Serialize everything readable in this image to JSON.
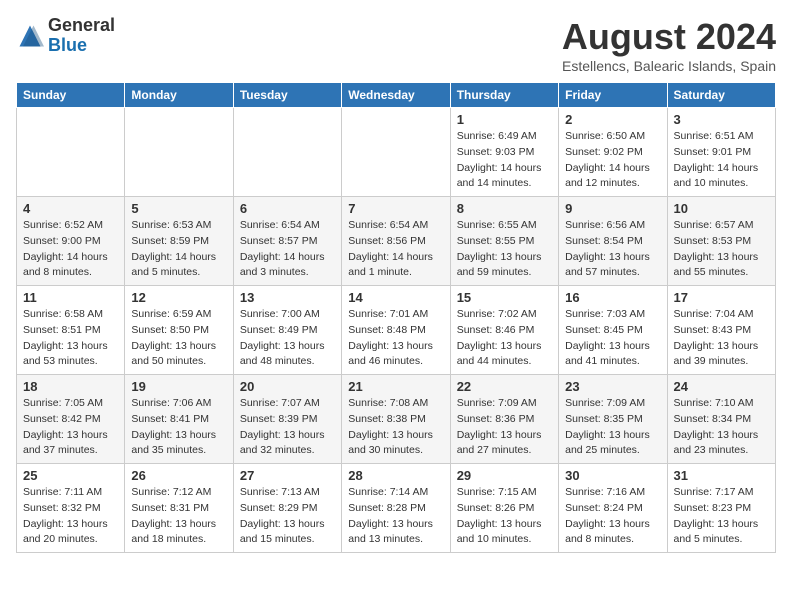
{
  "header": {
    "logo_general": "General",
    "logo_blue": "Blue",
    "main_title": "August 2024",
    "subtitle": "Estellencs, Balearic Islands, Spain"
  },
  "calendar": {
    "days_of_week": [
      "Sunday",
      "Monday",
      "Tuesday",
      "Wednesday",
      "Thursday",
      "Friday",
      "Saturday"
    ],
    "weeks": [
      [
        {
          "day": "",
          "info": ""
        },
        {
          "day": "",
          "info": ""
        },
        {
          "day": "",
          "info": ""
        },
        {
          "day": "",
          "info": ""
        },
        {
          "day": "1",
          "info": "Sunrise: 6:49 AM\nSunset: 9:03 PM\nDaylight: 14 hours\nand 14 minutes."
        },
        {
          "day": "2",
          "info": "Sunrise: 6:50 AM\nSunset: 9:02 PM\nDaylight: 14 hours\nand 12 minutes."
        },
        {
          "day": "3",
          "info": "Sunrise: 6:51 AM\nSunset: 9:01 PM\nDaylight: 14 hours\nand 10 minutes."
        }
      ],
      [
        {
          "day": "4",
          "info": "Sunrise: 6:52 AM\nSunset: 9:00 PM\nDaylight: 14 hours\nand 8 minutes."
        },
        {
          "day": "5",
          "info": "Sunrise: 6:53 AM\nSunset: 8:59 PM\nDaylight: 14 hours\nand 5 minutes."
        },
        {
          "day": "6",
          "info": "Sunrise: 6:54 AM\nSunset: 8:57 PM\nDaylight: 14 hours\nand 3 minutes."
        },
        {
          "day": "7",
          "info": "Sunrise: 6:54 AM\nSunset: 8:56 PM\nDaylight: 14 hours\nand 1 minute."
        },
        {
          "day": "8",
          "info": "Sunrise: 6:55 AM\nSunset: 8:55 PM\nDaylight: 13 hours\nand 59 minutes."
        },
        {
          "day": "9",
          "info": "Sunrise: 6:56 AM\nSunset: 8:54 PM\nDaylight: 13 hours\nand 57 minutes."
        },
        {
          "day": "10",
          "info": "Sunrise: 6:57 AM\nSunset: 8:53 PM\nDaylight: 13 hours\nand 55 minutes."
        }
      ],
      [
        {
          "day": "11",
          "info": "Sunrise: 6:58 AM\nSunset: 8:51 PM\nDaylight: 13 hours\nand 53 minutes."
        },
        {
          "day": "12",
          "info": "Sunrise: 6:59 AM\nSunset: 8:50 PM\nDaylight: 13 hours\nand 50 minutes."
        },
        {
          "day": "13",
          "info": "Sunrise: 7:00 AM\nSunset: 8:49 PM\nDaylight: 13 hours\nand 48 minutes."
        },
        {
          "day": "14",
          "info": "Sunrise: 7:01 AM\nSunset: 8:48 PM\nDaylight: 13 hours\nand 46 minutes."
        },
        {
          "day": "15",
          "info": "Sunrise: 7:02 AM\nSunset: 8:46 PM\nDaylight: 13 hours\nand 44 minutes."
        },
        {
          "day": "16",
          "info": "Sunrise: 7:03 AM\nSunset: 8:45 PM\nDaylight: 13 hours\nand 41 minutes."
        },
        {
          "day": "17",
          "info": "Sunrise: 7:04 AM\nSunset: 8:43 PM\nDaylight: 13 hours\nand 39 minutes."
        }
      ],
      [
        {
          "day": "18",
          "info": "Sunrise: 7:05 AM\nSunset: 8:42 PM\nDaylight: 13 hours\nand 37 minutes."
        },
        {
          "day": "19",
          "info": "Sunrise: 7:06 AM\nSunset: 8:41 PM\nDaylight: 13 hours\nand 35 minutes."
        },
        {
          "day": "20",
          "info": "Sunrise: 7:07 AM\nSunset: 8:39 PM\nDaylight: 13 hours\nand 32 minutes."
        },
        {
          "day": "21",
          "info": "Sunrise: 7:08 AM\nSunset: 8:38 PM\nDaylight: 13 hours\nand 30 minutes."
        },
        {
          "day": "22",
          "info": "Sunrise: 7:09 AM\nSunset: 8:36 PM\nDaylight: 13 hours\nand 27 minutes."
        },
        {
          "day": "23",
          "info": "Sunrise: 7:09 AM\nSunset: 8:35 PM\nDaylight: 13 hours\nand 25 minutes."
        },
        {
          "day": "24",
          "info": "Sunrise: 7:10 AM\nSunset: 8:34 PM\nDaylight: 13 hours\nand 23 minutes."
        }
      ],
      [
        {
          "day": "25",
          "info": "Sunrise: 7:11 AM\nSunset: 8:32 PM\nDaylight: 13 hours\nand 20 minutes."
        },
        {
          "day": "26",
          "info": "Sunrise: 7:12 AM\nSunset: 8:31 PM\nDaylight: 13 hours\nand 18 minutes."
        },
        {
          "day": "27",
          "info": "Sunrise: 7:13 AM\nSunset: 8:29 PM\nDaylight: 13 hours\nand 15 minutes."
        },
        {
          "day": "28",
          "info": "Sunrise: 7:14 AM\nSunset: 8:28 PM\nDaylight: 13 hours\nand 13 minutes."
        },
        {
          "day": "29",
          "info": "Sunrise: 7:15 AM\nSunset: 8:26 PM\nDaylight: 13 hours\nand 10 minutes."
        },
        {
          "day": "30",
          "info": "Sunrise: 7:16 AM\nSunset: 8:24 PM\nDaylight: 13 hours\nand 8 minutes."
        },
        {
          "day": "31",
          "info": "Sunrise: 7:17 AM\nSunset: 8:23 PM\nDaylight: 13 hours\nand 5 minutes."
        }
      ]
    ]
  }
}
